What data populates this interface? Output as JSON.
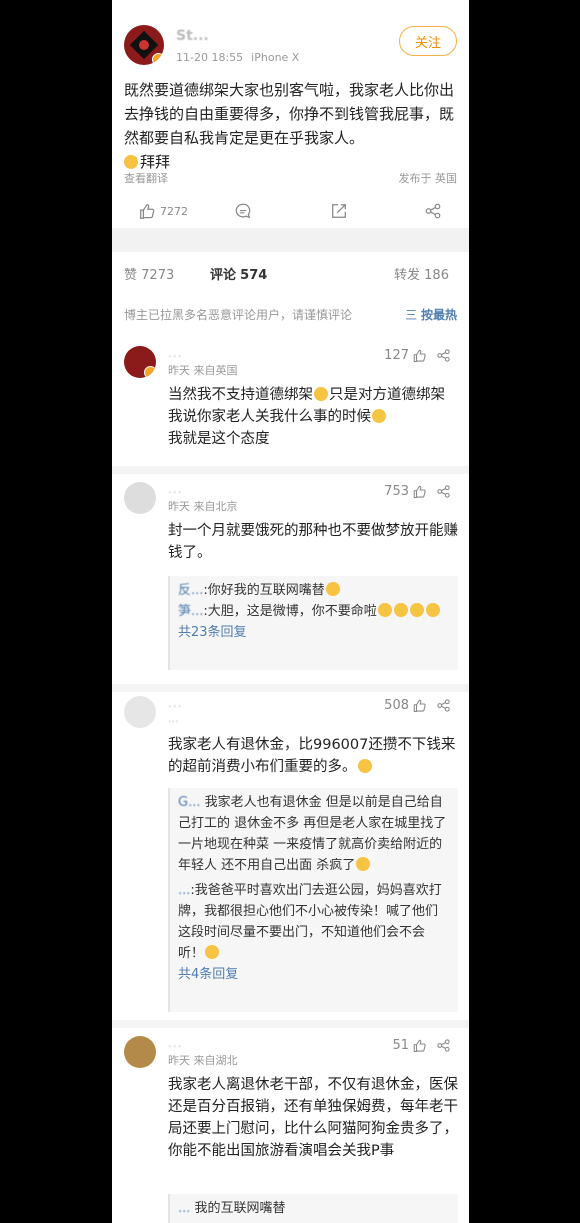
{
  "post": {
    "user": "St...",
    "time": "11-20 18:55",
    "device": "iPhone X",
    "follow_label": "关注",
    "body": "既然要道德绑架大家也别客气啦，我家老人比你出去挣钱的自由重要得多，你挣不到钱管我屁事，既然都要自私我肯定是更在乎我家人。",
    "body_tail": "拜拜",
    "translate_label": "查看翻译",
    "location": "发布于 英国",
    "likes": "7272"
  },
  "stats": {
    "likes_label": "赞",
    "likes": "7273",
    "comments_label": "评论",
    "comments": "574",
    "reposts_label": "转发",
    "reposts": "186"
  },
  "notice": {
    "text": "博主已拉黑多名恶意评论用户，请谨慎评论",
    "sort_icon": "三",
    "sort_label": "按最热"
  },
  "comments": [
    {
      "user": "...",
      "meta": "昨天  来自英国",
      "likes": "127",
      "body": "当然我不支持道德绑架",
      "body2": "只是对方道德绑架我说你家老人关我什么事的时候",
      "body3": "我就是这个态度"
    },
    {
      "user": "...",
      "meta": "昨天  来自北京",
      "likes": "753",
      "body": "封一个月就要饿死的那种也不要做梦放开能赚钱了。",
      "replies": [
        {
          "name": "反...",
          "text": ":你好我的互联网嘴替"
        },
        {
          "name": "笋...",
          "text": ":大胆，这是微博，你不要命啦"
        }
      ],
      "more": "共23条回复"
    },
    {
      "user": "...",
      "meta": "...",
      "likes": "508",
      "body": "我家老人有退休金，比996007还攒不下钱来的超前消费小布们重要的多。",
      "replies": [
        {
          "name": "G...",
          "text": "我家老人也有退休金 但是以前是自己给自己打工的 退休金不多 再但是老人家在城里找了一片地现在种菜 一来疫情了就高价卖给附近的年轻人 还不用自己出面 杀疯了"
        },
        {
          "name": "...",
          "text": ":我爸爸平时喜欢出门去逛公园，妈妈喜欢打牌，我都很担心他们不小心被传染！喊了他们这段时间尽量不要出门，不知道他们会不会听！"
        }
      ],
      "more": "共4条回复"
    },
    {
      "user": "...",
      "meta": "昨天  来自湖北",
      "likes": "51",
      "body": "我家老人离退休老干部，不仅有退休金，医保还是百分百报销，还有单独保姆费，每年老干局还要上门慰问，比什么阿猫阿狗金贵多了，你能不能出国旅游看演唱会关我P事",
      "replies": [
        {
          "name": "...",
          "text": "我的互联网嘴替"
        }
      ]
    }
  ],
  "colors": {
    "accent": "#f28c00",
    "link": "#507daf",
    "background": "#000000"
  }
}
